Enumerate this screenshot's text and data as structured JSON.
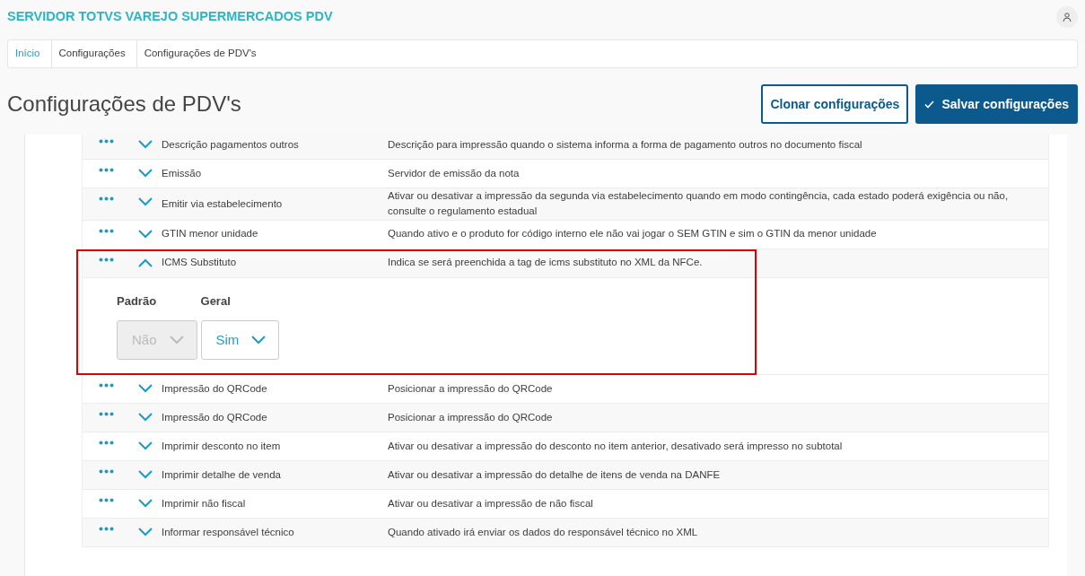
{
  "app_title": "SERVIDOR TOTVS VAREJO SUPERMERCADOS PDV",
  "breadcrumb": [
    {
      "label": "Início",
      "link": true
    },
    {
      "label": "Configurações",
      "link": false
    },
    {
      "label": "Configurações de PDV's",
      "link": false
    }
  ],
  "page_title": "Configurações de PDV's",
  "buttons": [
    {
      "label": "Clonar configurações",
      "kind": "outline"
    },
    {
      "label": "Salvar configurações",
      "kind": "primary"
    }
  ],
  "rows": [
    {
      "name": "Descrição pagamentos outros",
      "description": "Descrição para impressão quando o sistema informa a forma de pagamento outros no documento fiscal",
      "expanded": false
    },
    {
      "name": "Emissão",
      "description": "Servidor de emissão da nota",
      "expanded": false
    },
    {
      "name": "Emitir via estabelecimento",
      "description": "Ativar ou desativar a impressão da segunda via estabelecimento quando em modo contingência, cada estado poderá exigência ou não, consulte o regulamento estadual",
      "expanded": false
    },
    {
      "name": "GTIN menor unidade",
      "description": "Quando ativo e o produto for código interno ele não vai jogar o SEM GTIN e sim o GTIN da menor unidade",
      "expanded": false
    },
    {
      "name": "ICMS Substituto",
      "description": "Indica se será preenchida a tag de icms substituto no XML da NFCe.",
      "expanded": true,
      "highlighted": true,
      "fields": [
        {
          "label": "Padrão",
          "value": "Não",
          "disabled": true
        },
        {
          "label": "Geral",
          "value": "Sim",
          "disabled": false
        }
      ]
    },
    {
      "name": "Impressão do QRCode",
      "description": "Posicionar a impressão do QRCode",
      "expanded": false
    },
    {
      "name": "Impressão do QRCode",
      "description": "Posicionar a impressão do QRCode",
      "expanded": false
    },
    {
      "name": "Imprimir desconto no item",
      "description": "Ativar ou desativar a impressão do desconto no item anterior, desativado será impresso no subtotal",
      "expanded": false
    },
    {
      "name": "Imprimir detalhe de venda",
      "description": "Ativar ou desativar a impressão do detalhe de itens de venda na DANFE",
      "expanded": false
    },
    {
      "name": "Imprimir não fiscal",
      "description": "Ativar ou desativar a impressão de não fiscal",
      "expanded": false
    },
    {
      "name": "Informar responsável técnico",
      "description": "Quando ativado irá enviar os dados do responsável técnico no XML",
      "expanded": false
    }
  ]
}
